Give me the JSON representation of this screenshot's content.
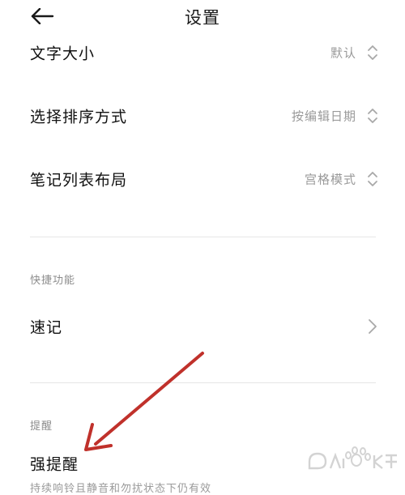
{
  "header": {
    "title": "设置"
  },
  "rows": {
    "font_size": {
      "label": "文字大小",
      "value": "默认"
    },
    "sort_order": {
      "label": "选择排序方式",
      "value": "按编辑日期"
    },
    "layout": {
      "label": "笔记列表布局",
      "value": "宫格模式"
    },
    "quick_note": {
      "label": "速记"
    },
    "strong_reminder": {
      "label": "强提醒",
      "desc": "持续响铃且静音和勿扰状态下仍有效"
    }
  },
  "sections": {
    "shortcuts": "快捷功能",
    "reminders": "提醒"
  },
  "icons": {
    "back": "arrow-left-icon",
    "updown": "up-down-chevron-icon",
    "chevron": "chevron-right-icon"
  },
  "colors": {
    "annotation_arrow": "#c0312b"
  }
}
